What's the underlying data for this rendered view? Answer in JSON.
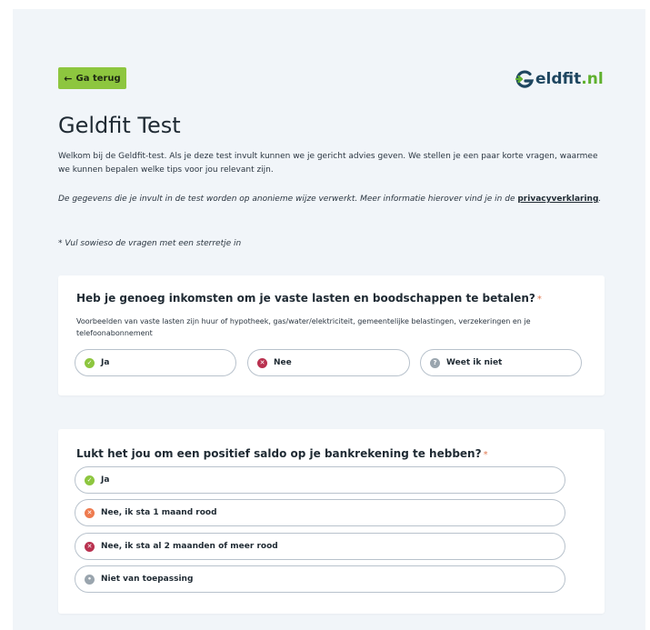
{
  "header": {
    "back_label": "Ga terug",
    "logo_main": "eldfit",
    "logo_suffix": ".nl",
    "logo_letter": "G"
  },
  "intro": {
    "title": "Geldfit Test",
    "text": "Welkom bij de Geldfit-test. Als je deze test invult kunnen we je gericht advies geven. We stellen je een paar korte vragen, waarmee we kunnen bepalen welke tips voor jou relevant zijn.",
    "privacy_text": "De gegevens die je invult in de test worden op anonieme wijze verwerkt. Meer informatie hierover vind je in de ",
    "privacy_link": "privacyverklaring",
    "privacy_end": ".",
    "required_note": "* Vul sowieso de vragen met een sterretje in"
  },
  "questions": [
    {
      "title": "Heb je genoeg inkomsten om je vaste lasten en boodschappen te betalen?",
      "required_mark": "*",
      "description": "Voorbeelden van vaste lasten zijn huur of hypotheek, gas/water/elektriciteit, gemeentelijke belastingen, verzekeringen en je telefoonabonnement",
      "options": [
        {
          "label": "Ja",
          "icon": "check-icon",
          "color": "#8dc63f",
          "glyph": "✓"
        },
        {
          "label": "Nee",
          "icon": "cross-icon",
          "color": "#b9314f",
          "glyph": "✕"
        },
        {
          "label": "Weet ik niet",
          "icon": "question-icon",
          "color": "#9aa5ae",
          "glyph": "?"
        }
      ]
    },
    {
      "title": "Lukt het jou om een positief saldo op je bankrekening te hebben?",
      "required_mark": "*",
      "options": [
        {
          "label": "Ja",
          "icon": "check-icon",
          "color": "#8dc63f",
          "glyph": "✓"
        },
        {
          "label": "Nee, ik sta 1 maand rood",
          "icon": "cross-icon",
          "color": "#ee7b4f",
          "glyph": "✕"
        },
        {
          "label": "Nee, ik sta al 2 maanden of meer rood",
          "icon": "cross-icon",
          "color": "#b9314f",
          "glyph": "✕"
        },
        {
          "label": "Niet van toepassing",
          "icon": "dot-icon",
          "color": "#9aa5ae",
          "glyph": "•"
        }
      ]
    }
  ],
  "colors": {
    "accent": "#8dc63f",
    "background": "#f1f5f9",
    "required": "#e07a52"
  }
}
